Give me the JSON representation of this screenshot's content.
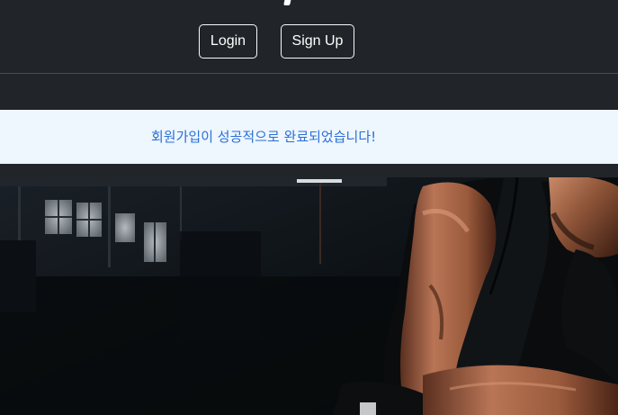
{
  "header": {
    "title_fragment": "",
    "login_label": "Login",
    "signup_label": "Sign Up"
  },
  "alert": {
    "message": "회원가입이 성공적으로 완료되었습니다!"
  },
  "hero": {
    "image_description_icon": "gym-athlete-photo"
  },
  "colors": {
    "header_bg": "#212529",
    "alert_bg": "#eef6fe",
    "alert_text": "#2b6fd6",
    "button_border": "#f8f9fa"
  }
}
